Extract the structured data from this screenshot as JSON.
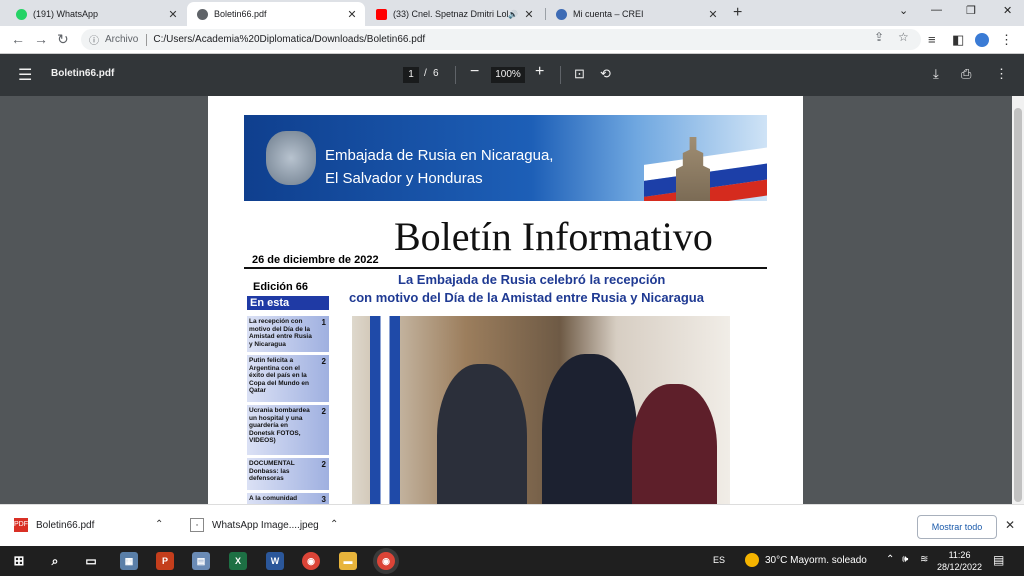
{
  "browser": {
    "tabs": [
      {
        "title": "(191) WhatsApp",
        "active": false
      },
      {
        "title": "Boletin66.pdf",
        "active": true
      },
      {
        "title": "(33) Cnel. Spetnaz Dmitri Lol",
        "active": false
      },
      {
        "title": "Mi cuenta – CREI",
        "active": false
      }
    ],
    "address": {
      "prefix": "Archivo",
      "url": "C:/Users/Academia%20Diplomatica/Downloads/Boletin66.pdf"
    }
  },
  "pdf": {
    "filename": "Boletin66.pdf",
    "page_current": "1",
    "page_sep": "/",
    "page_total": "6",
    "zoom": "100%"
  },
  "document": {
    "banner_line1": "Embajada de Rusia en Nicaragua,",
    "banner_line2": "El Salvador y Honduras",
    "title": "Boletín Informativo",
    "date": "26 de diciembre de 2022",
    "edition": "Edición 66",
    "in_this_edition": "En esta edición",
    "headline_line1": "La Embajada de Rusia celebró la recepción",
    "headline_line2": "con motivo del Día de la Amistad entre Rusia y Nicaragua",
    "toc": [
      {
        "text": "La recepción con motivo del Día de la Amistad entre Rusia y Nicaragua",
        "page": "1"
      },
      {
        "text": "Putin felicita a Argentina con el éxito del país en la Copa del Mundo en Qatar",
        "page": "2"
      },
      {
        "text": "Ucrania bombardea un hospital y una guardería en Donetsk FOTOS, VIDEOS)",
        "page": "2"
      },
      {
        "text": "DOCUMENTAL Donbass: las defensoras",
        "page": "2"
      },
      {
        "text": "A la comunidad",
        "page": "3"
      }
    ]
  },
  "downloads": {
    "items": [
      {
        "name": "Boletin66.pdf",
        "icon": "pdf-icon"
      },
      {
        "name": "WhatsApp Image....jpeg",
        "icon": "image-file-icon"
      }
    ],
    "show_all": "Mostrar todo"
  },
  "taskbar": {
    "lang": "ES",
    "weather": "30°C  Mayorm. soleado",
    "time": "11:26",
    "date": "28/12/2022"
  }
}
